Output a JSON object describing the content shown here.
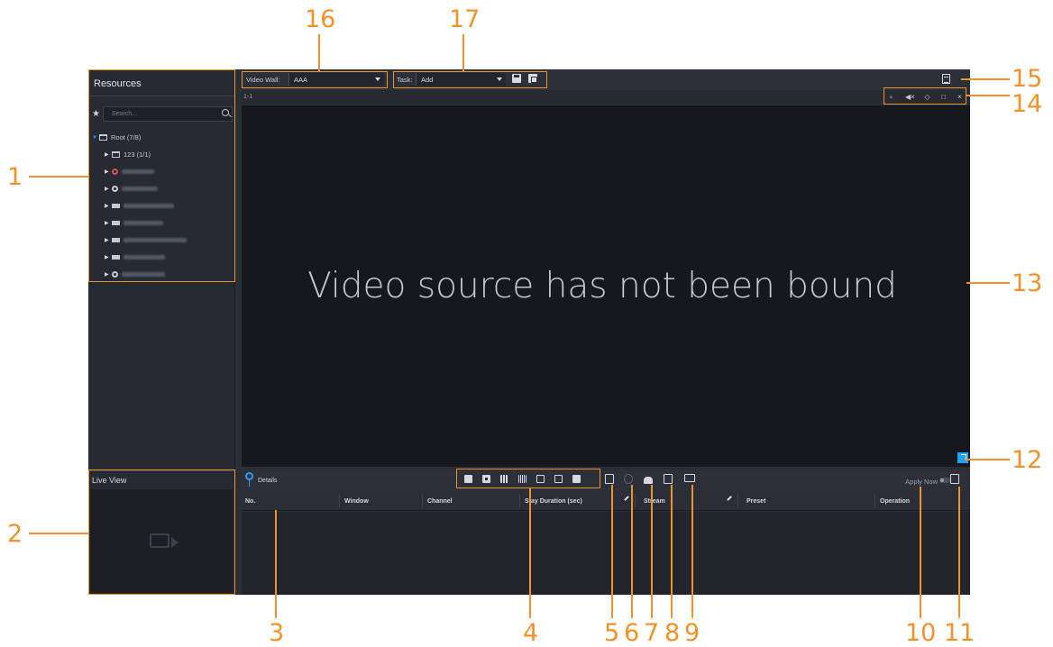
{
  "resources": {
    "title": "Resources",
    "search_placeholder": "Search...",
    "tree": [
      {
        "label": "Root (7/8)",
        "icon": "org-icon"
      },
      {
        "label": "123 (1/1)",
        "icon": "org-icon"
      },
      {
        "label": "",
        "icon": "camera-red-icon"
      },
      {
        "label": "",
        "icon": "camera-icon"
      },
      {
        "label": "",
        "icon": "nvr-icon"
      },
      {
        "label": "",
        "icon": "nvr-icon"
      },
      {
        "label": "",
        "icon": "nvr-icon"
      },
      {
        "label": "",
        "icon": "nvr-icon"
      },
      {
        "label": "",
        "icon": "camera-icon"
      }
    ]
  },
  "live_view": {
    "title": "Live View"
  },
  "toolbar": {
    "video_wall_label": "Video Wall:",
    "video_wall_value": "AAA",
    "task_label": "Task:",
    "task_value": "Add"
  },
  "window": {
    "title": "1-1"
  },
  "video": {
    "message": "Video source has not been bound"
  },
  "details": {
    "title": "Details",
    "apply_now": "Apply Now",
    "columns": [
      "No.",
      "Window",
      "Channel",
      "Stay Duration (sec)",
      "Stream",
      "Preset",
      "Operation"
    ]
  },
  "annotations": [
    "1",
    "2",
    "3",
    "4",
    "5",
    "6",
    "7",
    "8",
    "9",
    "10",
    "11",
    "12",
    "13",
    "14",
    "15",
    "16",
    "17"
  ],
  "colors": {
    "annotation": "#f0922b",
    "accent": "#2f9bf3",
    "background": "#2a2e37"
  }
}
